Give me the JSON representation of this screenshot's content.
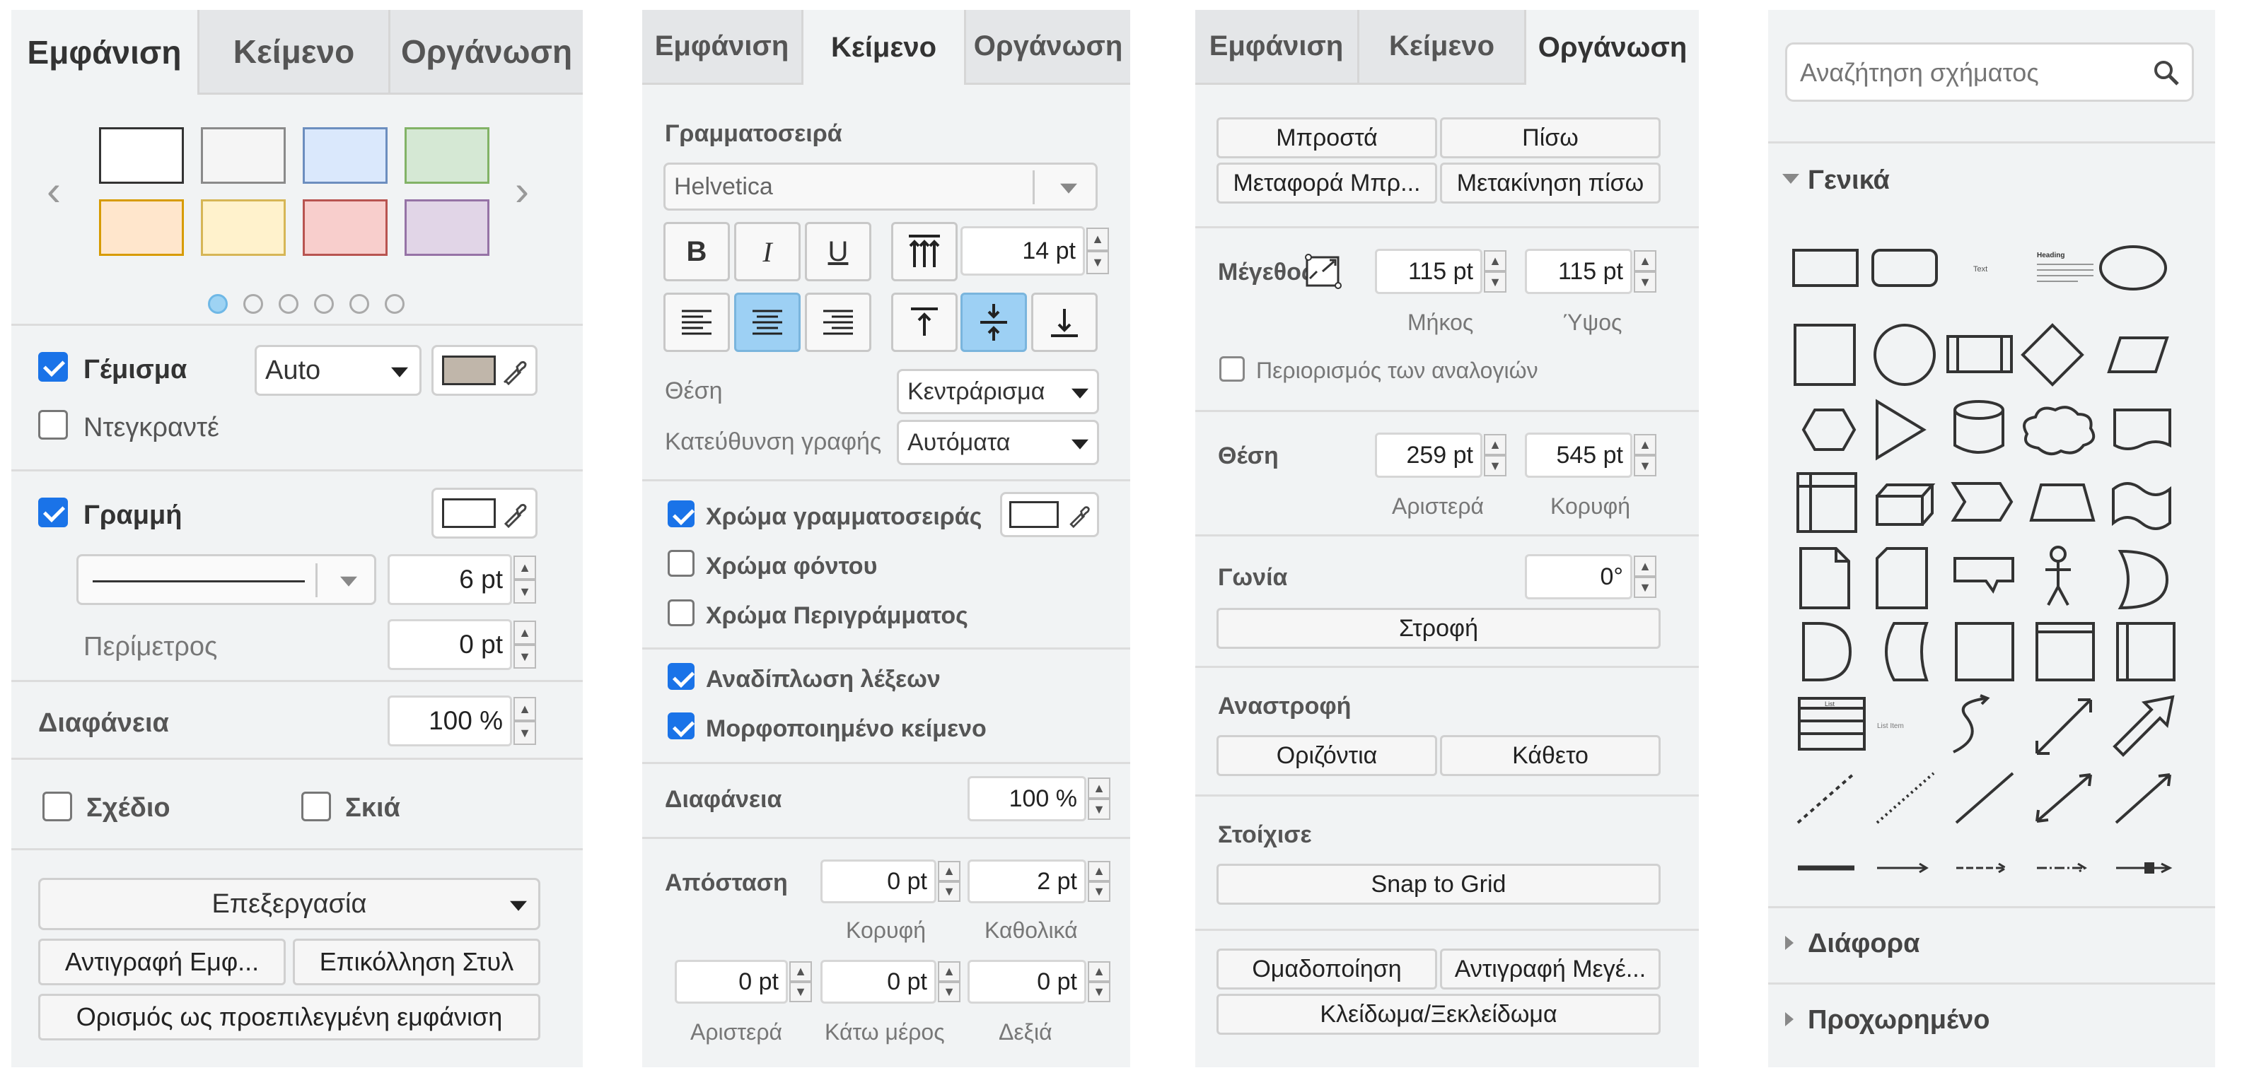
{
  "panel1": {
    "tabs": [
      "Εμφάνιση",
      "Κείμενο",
      "Οργάνωση"
    ],
    "fill_label": "Γέμισμα",
    "fill_mode": "Auto",
    "gradient_label": "Ντεγκραντέ",
    "line_label": "Γραμμή",
    "line_width": "6 pt",
    "perimeter_label": "Περίμετρος",
    "perimeter_value": "0 pt",
    "opacity_label": "Διαφάνεια",
    "opacity_value": "100 %",
    "sketch_label": "Σχέδιο",
    "shadow_label": "Σκιά",
    "edit_select": "Επεξεργασία",
    "copy_style": "Αντιγραφή Εμφ...",
    "paste_style": "Επικόλληση Στυλ",
    "set_default": "Ορισμός ως προεπιλεγμένη εμφάνιση",
    "fill_checked": true,
    "gradient_checked": false,
    "line_checked": true,
    "sketch_checked": false,
    "shadow_checked": false,
    "fill_color": "#c0b6aa",
    "swatches": [
      {
        "fill": "#ffffff",
        "stroke": "#333333"
      },
      {
        "fill": "#f5f5f5",
        "stroke": "#8a8a8a"
      },
      {
        "fill": "#dae8fc",
        "stroke": "#6c8ebf"
      },
      {
        "fill": "#d5e8d4",
        "stroke": "#82b366"
      },
      {
        "fill": "#ffe6cc",
        "stroke": "#d79b00"
      },
      {
        "fill": "#fff2cc",
        "stroke": "#d6b656"
      },
      {
        "fill": "#f8cecc",
        "stroke": "#b85450"
      },
      {
        "fill": "#e1d5e7",
        "stroke": "#9673a6"
      }
    ]
  },
  "panel2": {
    "tabs": [
      "Εμφάνιση",
      "Κείμενο",
      "Οργάνωση"
    ],
    "font_label": "Γραμματοσειρά",
    "font_value": "Helvetica",
    "font_size": "14 pt",
    "position_label": "Θέση",
    "position_value": "Κεντράρισμα",
    "direction_label": "Κατεύθυνση γραφής",
    "direction_value": "Αυτόματα",
    "font_color_label": "Χρώμα γραμματοσειράς",
    "bg_color_label": "Χρώμα φόντου",
    "border_color_label": "Χρώμα Περιγράμματος",
    "word_wrap_label": "Αναδίπλωση λέξεων",
    "formatted_label": "Μορφοποιημένο κείμενο",
    "opacity_label": "Διαφάνεια",
    "opacity_value": "100 %",
    "spacing_label": "Απόσταση",
    "top_value": "0 pt",
    "global_value": "2 pt",
    "top_label": "Κορυφή",
    "global_label": "Καθολικά",
    "left_value": "0 pt",
    "bottom_value": "0 pt",
    "right_value": "0 pt",
    "left_label": "Αριστερά",
    "bottom_label": "Κάτω μέρος",
    "right_label": "Δεξιά",
    "font_color_checked": true,
    "bg_color_checked": false,
    "border_color_checked": false,
    "word_wrap_checked": true,
    "formatted_checked": true
  },
  "panel3": {
    "tabs": [
      "Εμφάνιση",
      "Κείμενο",
      "Οργάνωση"
    ],
    "front": "Μπροστά",
    "back": "Πίσω",
    "bring_forward": "Μεταφορά Μπρ...",
    "send_backward": "Μετακίνηση πίσω",
    "size_label": "Μέγεθος",
    "width_value": "115 pt",
    "height_value": "115 pt",
    "width_label": "Μήκος",
    "height_label": "Ύψος",
    "constrain_label": "Περιορισμός των αναλογιών",
    "position_label": "Θέση",
    "left_value": "259 pt",
    "top_value": "545 pt",
    "left_label": "Αριστερά",
    "top_label": "Κορυφή",
    "angle_label": "Γωνία",
    "angle_value": "0°",
    "rotate": "Στροφή",
    "flip_label": "Αναστροφή",
    "flip_h": "Οριζόντια",
    "flip_v": "Κάθετο",
    "align_label": "Στοίχισε",
    "snap": "Snap to Grid",
    "group": "Ομαδοποίηση",
    "copy_size": "Αντιγραφή Μεγέ...",
    "lock": "Κλείδωμα/Ξεκλείδωμα",
    "constrain_checked": false
  },
  "panel4": {
    "search_placeholder": "Αναζήτηση σχήματος",
    "general": "Γενικά",
    "misc": "Διάφορα",
    "advanced": "Προχωρημένο",
    "text_shape": "Text",
    "heading_shape": "Heading",
    "list_shape": "List",
    "list_item_shape": "List Item"
  }
}
